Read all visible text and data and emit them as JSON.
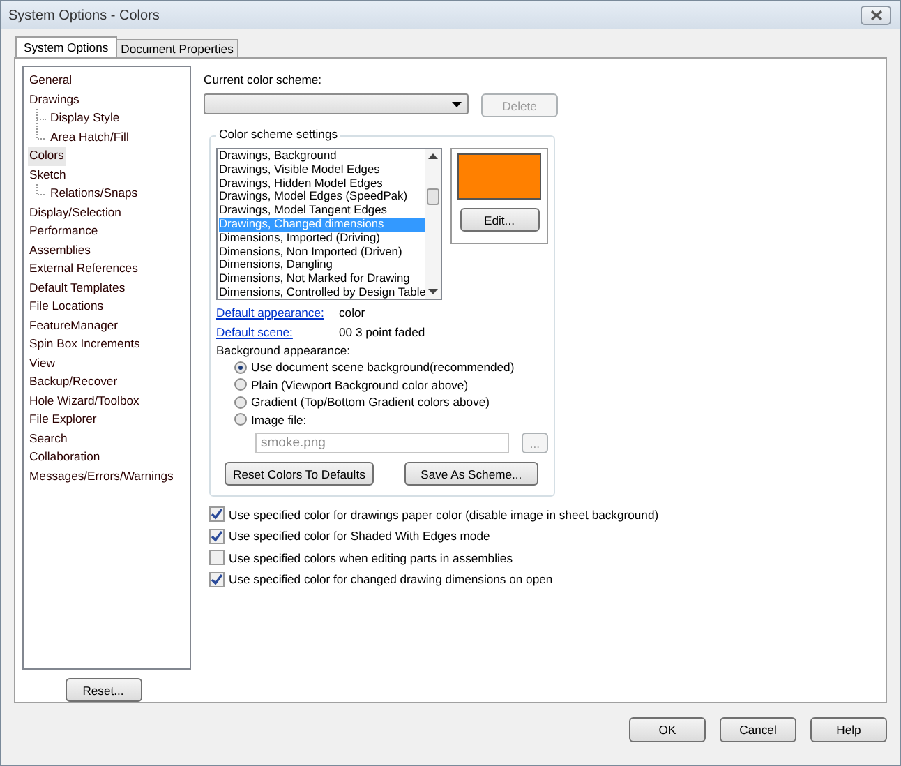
{
  "window": {
    "title": "System Options - Colors"
  },
  "tabs": [
    {
      "label": "System Options",
      "selected": true
    },
    {
      "label": "Document Properties",
      "selected": false
    }
  ],
  "tree": [
    {
      "label": "General",
      "selected": false
    },
    {
      "label": "Drawings",
      "selected": false,
      "children": [
        {
          "label": "Display Style",
          "selected": false
        },
        {
          "label": "Area Hatch/Fill",
          "selected": false
        }
      ]
    },
    {
      "label": "Colors",
      "selected": true
    },
    {
      "label": "Sketch",
      "selected": false,
      "children": [
        {
          "label": "Relations/Snaps",
          "selected": false
        }
      ]
    },
    {
      "label": "Display/Selection",
      "selected": false
    },
    {
      "label": "Performance",
      "selected": false
    },
    {
      "label": "Assemblies",
      "selected": false
    },
    {
      "label": "External References",
      "selected": false
    },
    {
      "label": "Default Templates",
      "selected": false
    },
    {
      "label": "File Locations",
      "selected": false
    },
    {
      "label": "FeatureManager",
      "selected": false
    },
    {
      "label": "Spin Box Increments",
      "selected": false
    },
    {
      "label": "View",
      "selected": false
    },
    {
      "label": "Backup/Recover",
      "selected": false
    },
    {
      "label": "Hole Wizard/Toolbox",
      "selected": false
    },
    {
      "label": "File Explorer",
      "selected": false
    },
    {
      "label": "Search",
      "selected": false
    },
    {
      "label": "Collaboration",
      "selected": false
    },
    {
      "label": "Messages/Errors/Warnings",
      "selected": false
    }
  ],
  "reset_button": "Reset...",
  "scheme": {
    "label": "Current color scheme:",
    "delete_button": "Delete",
    "delete_disabled": true
  },
  "settings": {
    "title": "Color scheme settings",
    "items": [
      {
        "label": "Drawings, Background",
        "selected": false
      },
      {
        "label": "Drawings, Visible Model Edges",
        "selected": false
      },
      {
        "label": "Drawings, Hidden Model Edges",
        "selected": false
      },
      {
        "label": "Drawings, Model Edges (SpeedPak)",
        "selected": false
      },
      {
        "label": "Drawings, Model Tangent Edges",
        "selected": false
      },
      {
        "label": "Drawings, Changed dimensions",
        "selected": true
      },
      {
        "label": "Dimensions, Imported (Driving)",
        "selected": false
      },
      {
        "label": "Dimensions, Non Imported (Driven)",
        "selected": false
      },
      {
        "label": "Dimensions, Dangling",
        "selected": false
      },
      {
        "label": "Dimensions, Not Marked for Drawing",
        "selected": false
      },
      {
        "label": "Dimensions, Controlled by Design Table",
        "selected": false
      }
    ],
    "swatch": {
      "color": "#ff8000"
    },
    "edit_button": "Edit...",
    "links": [
      {
        "label": "Default appearance:",
        "value": "color"
      },
      {
        "label": "Default scene:",
        "value": "00 3 point faded"
      }
    ],
    "background_label": "Background appearance:",
    "radios": [
      {
        "label": "Use document scene background(recommended)",
        "selected": true
      },
      {
        "label": "Plain (Viewport Background color above)",
        "selected": false
      },
      {
        "label": "Gradient (Top/Bottom Gradient colors above)",
        "selected": false
      },
      {
        "label": "Image file:",
        "selected": false
      }
    ],
    "image_file": {
      "value": "smoke.png",
      "disabled": true,
      "browse": "..."
    },
    "buttons": [
      "Reset Colors To Defaults",
      "Save As Scheme..."
    ]
  },
  "checkboxes": [
    {
      "label": "Use specified color for drawings paper color (disable image in sheet background)",
      "checked": true
    },
    {
      "label": "Use specified color for Shaded With Edges mode",
      "checked": true
    },
    {
      "label": "Use specified colors when editing parts in assemblies",
      "checked": false
    },
    {
      "label": "Use specified color for changed drawing dimensions on open",
      "checked": true
    }
  ],
  "footer_buttons": [
    "OK",
    "Cancel",
    "Help"
  ]
}
